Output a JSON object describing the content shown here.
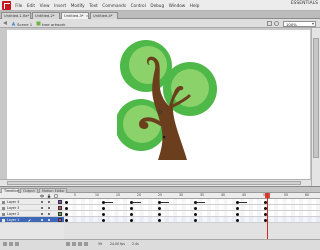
{
  "app": {
    "logo": "flash-logo",
    "workspace": "ESSENTIALS"
  },
  "menu": [
    "File",
    "Edit",
    "View",
    "Insert",
    "Modify",
    "Text",
    "Commands",
    "Control",
    "Debug",
    "Window",
    "Help"
  ],
  "doc_tabs": [
    "Untitled-1.fla*",
    "Untitled-2*",
    "Untitled-3*",
    "Untitled-4*"
  ],
  "edit_bar": {
    "scene": "Scene 1",
    "symbol": "tree artwork",
    "zoom": "100%"
  },
  "timeline": {
    "tabs": [
      "Timeline",
      "Output",
      "Motion Editor"
    ],
    "ruler": [
      "5",
      "10",
      "15",
      "20",
      "25",
      "30",
      "35",
      "40",
      "45",
      "50",
      "55",
      "60",
      "65"
    ],
    "layers": [
      {
        "name": "Layer 4",
        "color": "#7c4fd6",
        "selected": false
      },
      {
        "name": "Layer 3",
        "color": "#e0455a",
        "selected": false
      },
      {
        "name": "Layer 2",
        "color": "#58b148",
        "selected": false
      },
      {
        "name": "Layer 1",
        "color": "#9b48d1",
        "selected": true
      }
    ],
    "status": {
      "frame": "59",
      "fps": "24.00 fps",
      "time": "2.4s"
    }
  },
  "colors": {
    "leaf_light": "#8bd26b",
    "leaf_dark": "#4eb848",
    "trunk": "#6b3f1d",
    "playhead": "#d9261c"
  }
}
